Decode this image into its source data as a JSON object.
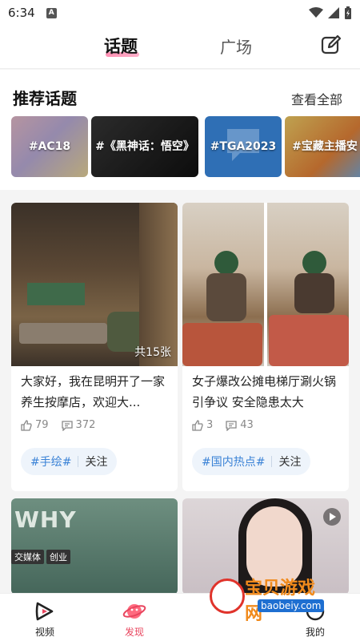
{
  "status": {
    "time": "6:34",
    "notification_glyph": "A"
  },
  "header": {
    "tab_topic": "话题",
    "tab_square": "广场",
    "edit_icon": "edit-icon"
  },
  "recommended": {
    "title": "推荐话题",
    "see_all": "查看全部",
    "topics": [
      {
        "label": "#AC18"
      },
      {
        "label": "#《黑神话：悟空》"
      },
      {
        "label": "#TGA2023"
      },
      {
        "label": "#宝藏主播安"
      }
    ]
  },
  "feed": [
    {
      "title": "大家好，我在昆明开了一家养生按摩店，欢迎大...",
      "photo_count": "共15张",
      "likes": "79",
      "comments": "372",
      "tag": "#手绘#",
      "follow": "关注"
    },
    {
      "title": "女子爆改公摊电梯厅涮火锅引争议 安全隐患太大",
      "photo_count": "",
      "likes": "3",
      "comments": "43",
      "tag": "#国内热点#",
      "follow": "关注"
    }
  ],
  "feed_more": {
    "card1_logo": "WHY",
    "card1_tags": [
      "交媒体",
      "创业"
    ]
  },
  "nav": {
    "video": "视频",
    "discover": "发现",
    "mine": "我的"
  },
  "watermark": {
    "text": "宝贝游戏网",
    "url": "baobeiy.com"
  },
  "colors": {
    "accent": "#e8455e",
    "tag_blue": "#3a82d6"
  }
}
